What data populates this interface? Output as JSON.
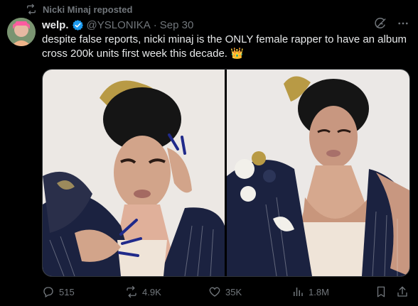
{
  "repost": {
    "label": "Nicki Minaj reposted"
  },
  "author": {
    "display_name": "welp.",
    "handle": "@YSLONIKA",
    "separator": "·",
    "date": "Sep 30"
  },
  "tweet": {
    "text": "despite false reports, nicki minaj is the ONLY female rapper to have an album cross 200k units first week this decade.",
    "emoji": "👑"
  },
  "metrics": {
    "replies": "515",
    "reposts": "4.9K",
    "likes": "35K",
    "views": "1.8M"
  },
  "colors": {
    "background": "#000000",
    "text": "#e7e9ea",
    "muted": "#71767b",
    "verified": "#1d9bf0"
  },
  "icons": {
    "repost": "repost-icon",
    "verified": "verified-badge-icon",
    "grok": "grok-icon",
    "more": "more-icon",
    "reply": "reply-icon",
    "like": "heart-icon",
    "views": "views-icon",
    "bookmark": "bookmark-icon",
    "share": "share-icon"
  }
}
